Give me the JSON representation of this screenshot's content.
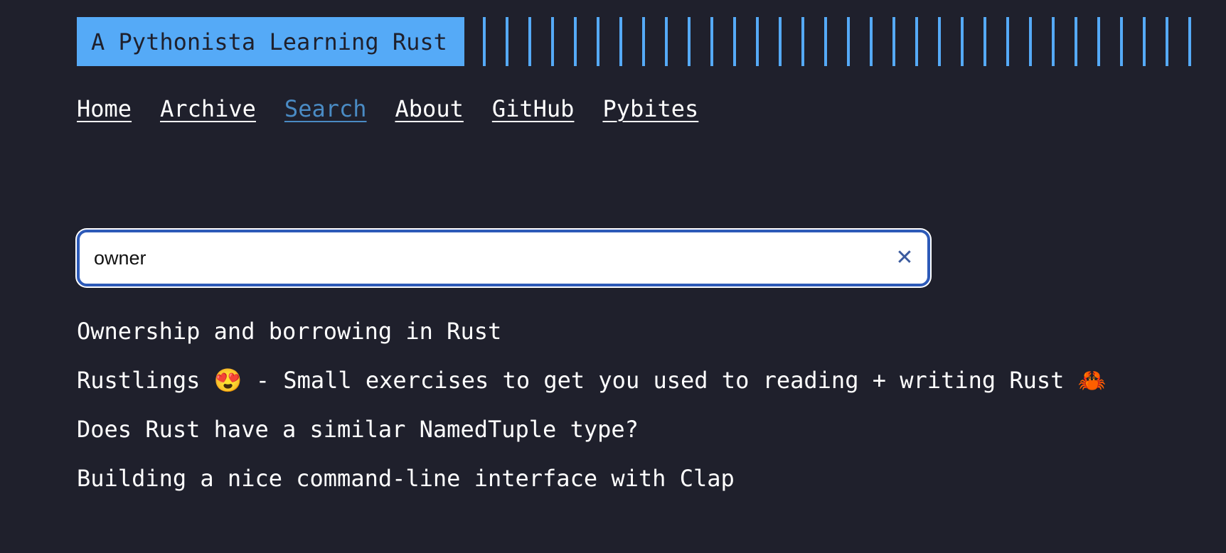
{
  "site": {
    "title": "A Pythonista Learning Rust"
  },
  "nav": {
    "items": [
      {
        "label": "Home"
      },
      {
        "label": "Archive"
      },
      {
        "label": "Search"
      },
      {
        "label": "About"
      },
      {
        "label": "GitHub"
      },
      {
        "label": "Pybites"
      }
    ],
    "active": "Search"
  },
  "search": {
    "value": "owner",
    "clear_icon": "close-icon"
  },
  "results": [
    {
      "title": "Ownership and borrowing in Rust"
    },
    {
      "title": "Rustlings 😍 - Small exercises to get you used to reading + writing Rust 🦀"
    },
    {
      "title": "Does Rust have a similar NamedTuple type?"
    },
    {
      "title": "Building a nice command-line interface with Clap"
    }
  ],
  "colors": {
    "background": "#1f202c",
    "accent": "#55aaf7",
    "active_link": "#4a8bc4",
    "input_border": "#2d5ab8"
  }
}
